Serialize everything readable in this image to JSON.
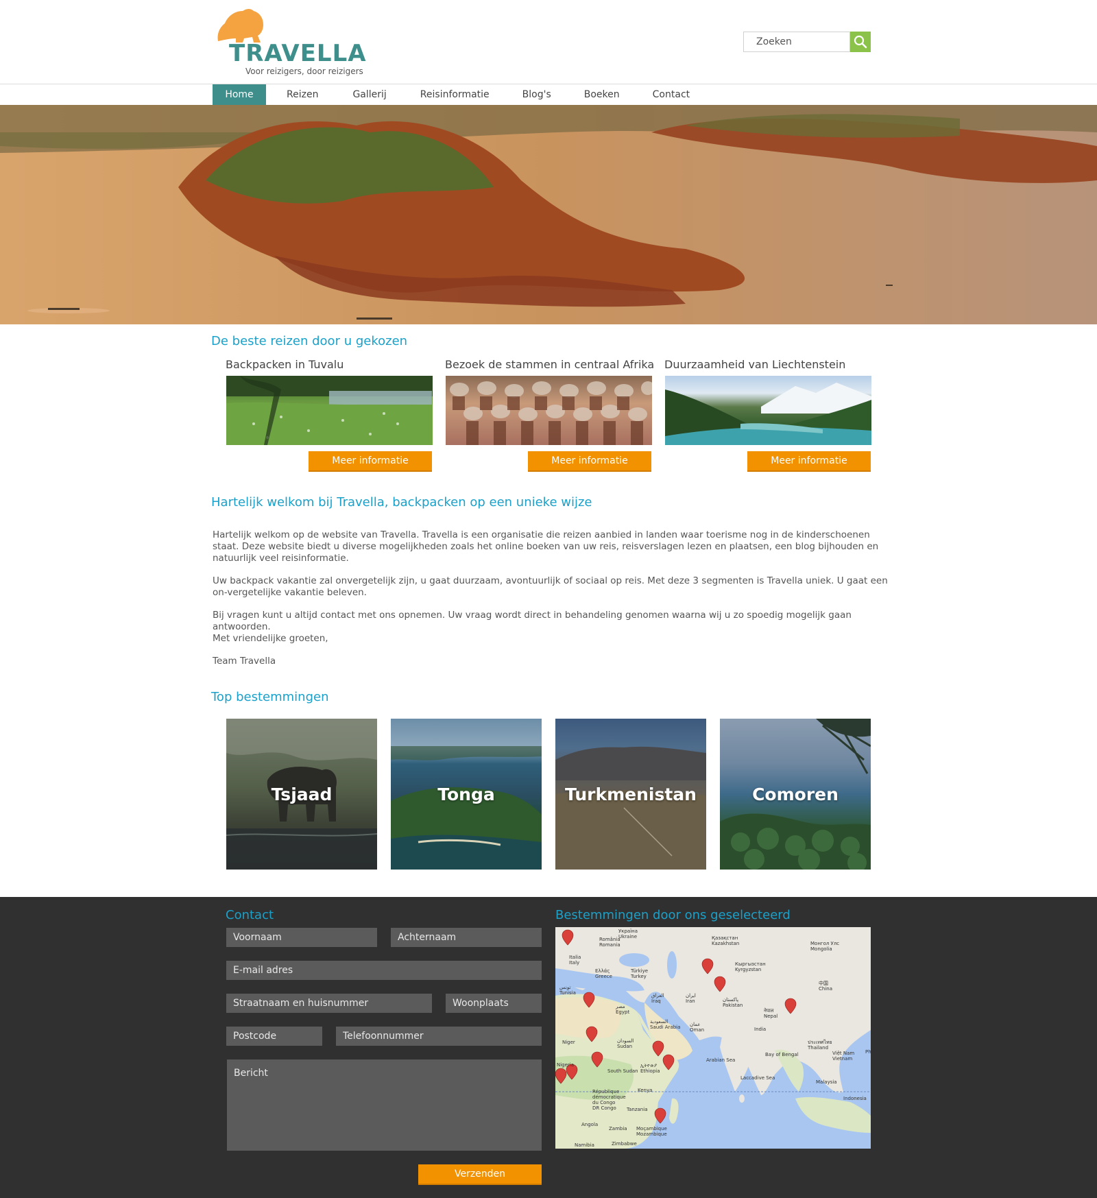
{
  "header": {
    "logo_name": "TRAVELLA",
    "logo_tagline": "Voor reizigers, door reizigers",
    "search_placeholder": "Zoeken",
    "logo_color": "#3e8f8c",
    "logo_icon_color": "#f4a340"
  },
  "nav": {
    "items": [
      "Home",
      "Reizen",
      "Gallerij",
      "Reisinformatie",
      "Blog's",
      "Boeken",
      "Contact"
    ],
    "active": "Home",
    "active_color": "#3e8f8c"
  },
  "trips": {
    "heading": "De beste reizen door u gekozen",
    "button_label": "Meer informatie",
    "items": [
      {
        "title": "Backpacken in Tuvalu"
      },
      {
        "title": "Bezoek de stammen in centraal Afrika"
      },
      {
        "title": "Duurzaamheid van Liechtenstein"
      }
    ]
  },
  "welcome": {
    "heading": "Hartelijk welkom bij Travella, backpacken op een unieke wijze",
    "paragraphs": [
      "Hartelijk welkom op de website van Travella. Travella is een organisatie die reizen aanbied in landen waar toerisme nog in de kinderschoenen staat. Deze website biedt u diverse mogelijkheden zoals het online boeken van uw reis, reisverslagen lezen en plaatsen, een blog bijhouden en natuurlijk veel reisinformatie.",
      "Uw backpack vakantie zal onvergetelijk zijn, u gaat duurzaam, avontuurlijk of sociaal op reis. Met deze 3 segmenten is Travella uniek. U gaat een on-vergetelijke vakantie beleven.",
      "Bij vragen kunt u altijd contact met ons opnemen. Uw vraag wordt direct in behandeling genomen waarna wij u zo spoedig mogelijk gaan antwoorden.",
      "Met vriendelijke groeten,",
      "Team Travella"
    ]
  },
  "destinations": {
    "heading": "Top bestemmingen",
    "items": [
      "Tsjaad",
      "Tonga",
      "Turkmenistan",
      "Comoren"
    ]
  },
  "contact": {
    "heading": "Contact",
    "fields": {
      "voornaam": "Voornaam",
      "achternaam": "Achternaam",
      "email": "E-mail adres",
      "straat": "Straatnaam en huisnummer",
      "woonplaats": "Woonplaats",
      "postcode": "Postcode",
      "telefoon": "Telefoonnummer",
      "bericht": "Bericht"
    },
    "submit_label": "Verzenden"
  },
  "map": {
    "heading": "Bestemmingen door ons geselecteerd",
    "labels": {
      "ukraine": "Україна\nUkraine",
      "romania": "România\nRomania",
      "italy": "Italia\nItaly",
      "greece": "Ελλάς\nGreece",
      "turkey": "Türkiye\nTurkey",
      "kazakhstan": "Қазақстан\nKazakhstan",
      "mongolia": "Монгол Улс\nMongolia",
      "kyrgyzstan": "Кыргызстан\nKyrgyzstan",
      "china": "中国\nChina",
      "tunisia": "تونس\nTunisia",
      "iraq": "العراق\nIraq",
      "iran": "ایران\nIran",
      "pakistan": "پاکستان\nPakistan",
      "nepal": "नेपाल\nNepal",
      "egypt": "مصر\nEgypt",
      "saudi": "السعودية\nSaudi Arabia",
      "oman": "عمان\nOman",
      "india": "India",
      "niger": "Niger",
      "sudan": "السودان\nSudan",
      "thailand": "ประเทศไทย\nThailand",
      "vietnam": "Việt Nam\nVietnam",
      "nigeria": "Nigeria",
      "southsudan": "South Sudan",
      "ethiopia": "ኢትዮጵያ\nEthiopia",
      "arabiansea": "Arabian Sea",
      "bayofbengal": "Bay of Bengal",
      "laccadive": "Laccadive Sea",
      "malaysia": "Malaysia",
      "drc": "République\ndémocratique\ndu Congo\nDR Congo",
      "kenya": "Kenya",
      "indonesia": "Indonesia",
      "tanzania": "Tanzania",
      "angola": "Angola",
      "zambia": "Zambia",
      "mozambique": "Moçambique\nMozambique",
      "namibia": "Namibia",
      "zimbabwe": "Zimbabwe",
      "ph": "Ph"
    }
  },
  "colors": {
    "heading_blue": "#1ba1c9",
    "button_orange": "#f39200",
    "search_green": "#8bc34a",
    "footer_bg": "#303030",
    "field_bg": "#5b5b5b"
  }
}
